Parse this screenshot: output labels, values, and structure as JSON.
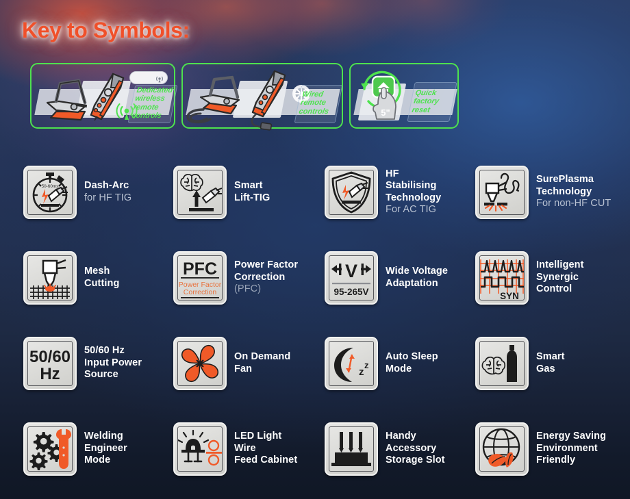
{
  "page": {
    "title": "Key to Symbols:",
    "title_color": "#f0502a",
    "accent_orange": "#f0502a",
    "accent_green": "#4ee24e",
    "label_color": "#ffffff",
    "sublabel_color": "#b9c2d2",
    "icon_plate_color": "#dcdcd9"
  },
  "panels": [
    {
      "id": "dedicated-wireless-remote-controls",
      "caption": "Dedicated\nwireless\nremote\ncontrols",
      "items": [
        "earth-clamp-device",
        "wireless-torch-remote",
        "wireless-signal-badge"
      ]
    },
    {
      "id": "wired-remote-controls",
      "caption": "Wired\nremote\ncontrols",
      "items": [
        "earth-clamp-with-cable",
        "wired-torch-remote",
        "gear-badge"
      ]
    },
    {
      "id": "quick-factory-reset",
      "caption": "Quick\nfactory\nreset",
      "items": [
        "reset-button-press",
        "hold-duration-5s"
      ],
      "hold_duration": "5\""
    }
  ],
  "features": [
    {
      "icon": "stopwatch-torch-icon",
      "icon_text": "50-60ms",
      "line1": "Dash-Arc",
      "line2": "for HF TIG",
      "line2_style": "sub"
    },
    {
      "icon": "brain-lift-torch-icon",
      "line1": "Smart",
      "line2": "Lift-TIG",
      "line2_style": "main"
    },
    {
      "icon": "shield-torch-icon",
      "line1": "HF Stabilising",
      "line2": "Technology",
      "line2_style": "main",
      "line3": "For AC TIG",
      "line3_style": "sub"
    },
    {
      "icon": "plasma-waveform-icon",
      "line1": "SurePlasma",
      "line2": "Technology",
      "line2_style": "main",
      "line3": "For non-HF CUT",
      "line3_style": "sub"
    },
    {
      "icon": "mesh-cutting-icon",
      "line1": "Mesh",
      "line2": "Cutting",
      "line2_style": "main"
    },
    {
      "icon": "pfc-icon",
      "icon_text": "PFC",
      "icon_subtext": "Power Factor\nCorrection",
      "line1": "Power Factor",
      "line2": "Correction",
      "line2_style": "main",
      "line2_suffix": " (PFC)"
    },
    {
      "icon": "wide-voltage-icon",
      "icon_text": "V",
      "icon_subtext": "95-265V",
      "line1": "Wide Voltage",
      "line2": "Adaptation",
      "line2_style": "main"
    },
    {
      "icon": "synergic-waveform-icon",
      "icon_text": "SYN",
      "line1": "Intelligent",
      "line2": "Synergic",
      "line2_style": "main",
      "line3": "Control",
      "line3_style": "main"
    },
    {
      "icon": "frequency-icon",
      "icon_text": "50/60",
      "icon_subtext": "Hz",
      "line1": "50/60 Hz",
      "line2": "Input Power",
      "line2_style": "main",
      "line3": "Source",
      "line3_style": "main"
    },
    {
      "icon": "fan-icon",
      "line1": "On Demand",
      "line2": "Fan",
      "line2_style": "main"
    },
    {
      "icon": "moon-sleep-icon",
      "icon_text": "zz",
      "line1": "Auto Sleep",
      "line2": "Mode",
      "line2_style": "main"
    },
    {
      "icon": "brain-gas-bottle-icon",
      "line1": "Smart",
      "line2": "Gas",
      "line2_style": "main"
    },
    {
      "icon": "gears-wrench-icon",
      "line1": "Welding",
      "line2": "Engineer",
      "line2_style": "main",
      "line3": "Mode",
      "line3_style": "main"
    },
    {
      "icon": "led-light-wire-feed-icon",
      "line1": "LED Light Wire",
      "line2": "Feed Cabinet",
      "line2_style": "main"
    },
    {
      "icon": "accessory-storage-slot-icon",
      "line1": "Handy",
      "line2": "Accessory",
      "line2_style": "main",
      "line3": "Storage Slot",
      "line3_style": "main"
    },
    {
      "icon": "globe-leaf-icon",
      "line1": "Energy Saving",
      "line2": "Environment",
      "line2_style": "main",
      "line3": "Friendly",
      "line3_style": "main"
    }
  ]
}
